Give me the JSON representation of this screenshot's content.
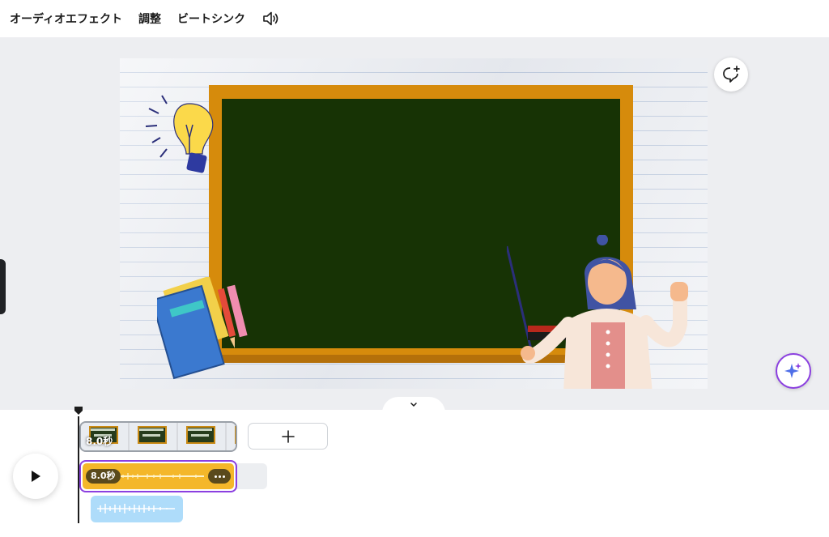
{
  "toolbar": {
    "audio_effects": "オーディオエフェクト",
    "adjust": "調整",
    "beat_sync": "ビートシンク",
    "speaker_icon": "speaker-icon"
  },
  "canvas": {
    "comment_icon": "comment-add-icon",
    "magic_icon": "sparkle-icon",
    "colors": {
      "board_frame": "#d68b0c",
      "board": "#173305",
      "accent": "#8b3fe0"
    }
  },
  "timeline": {
    "video_clip_duration": "8.0秒",
    "audio_clip_duration": "8.0秒",
    "add_icon": "plus-icon",
    "play_icon": "play-icon",
    "more_icon": "more-horizontal-icon",
    "collapse_icon": "chevron-down-icon",
    "colors": {
      "audio_clip": "#f4b72a",
      "audio_clip_2": "#aedcfa",
      "selection": "#8b3fe0"
    }
  }
}
